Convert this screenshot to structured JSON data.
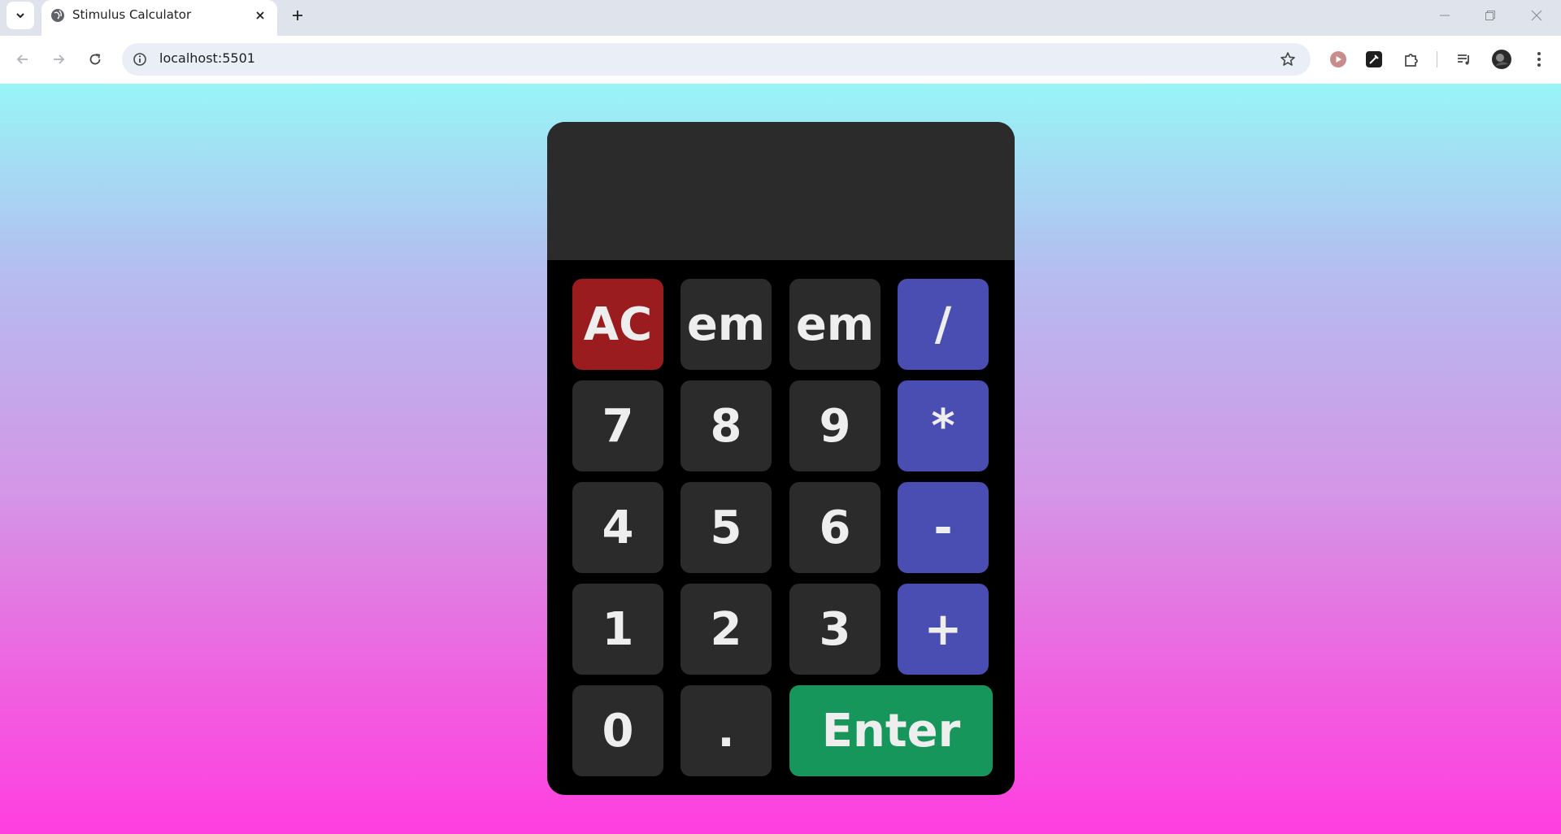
{
  "browser": {
    "tab_title": "Stimulus Calculator",
    "url": "localhost:5501"
  },
  "calculator": {
    "display": "",
    "keys": {
      "clear": "AC",
      "em1": "em",
      "em2": "em",
      "divide": "/",
      "seven": "7",
      "eight": "8",
      "nine": "9",
      "multiply": "*",
      "four": "4",
      "five": "5",
      "six": "6",
      "minus": "-",
      "one": "1",
      "two": "2",
      "three": "3",
      "plus": "+",
      "zero": "0",
      "dot": ".",
      "enter": "Enter"
    },
    "colors": {
      "clear": "#9a1c1f",
      "operator": "#4a4db2",
      "enter": "#16965a",
      "number": "#2c2b2c"
    }
  }
}
